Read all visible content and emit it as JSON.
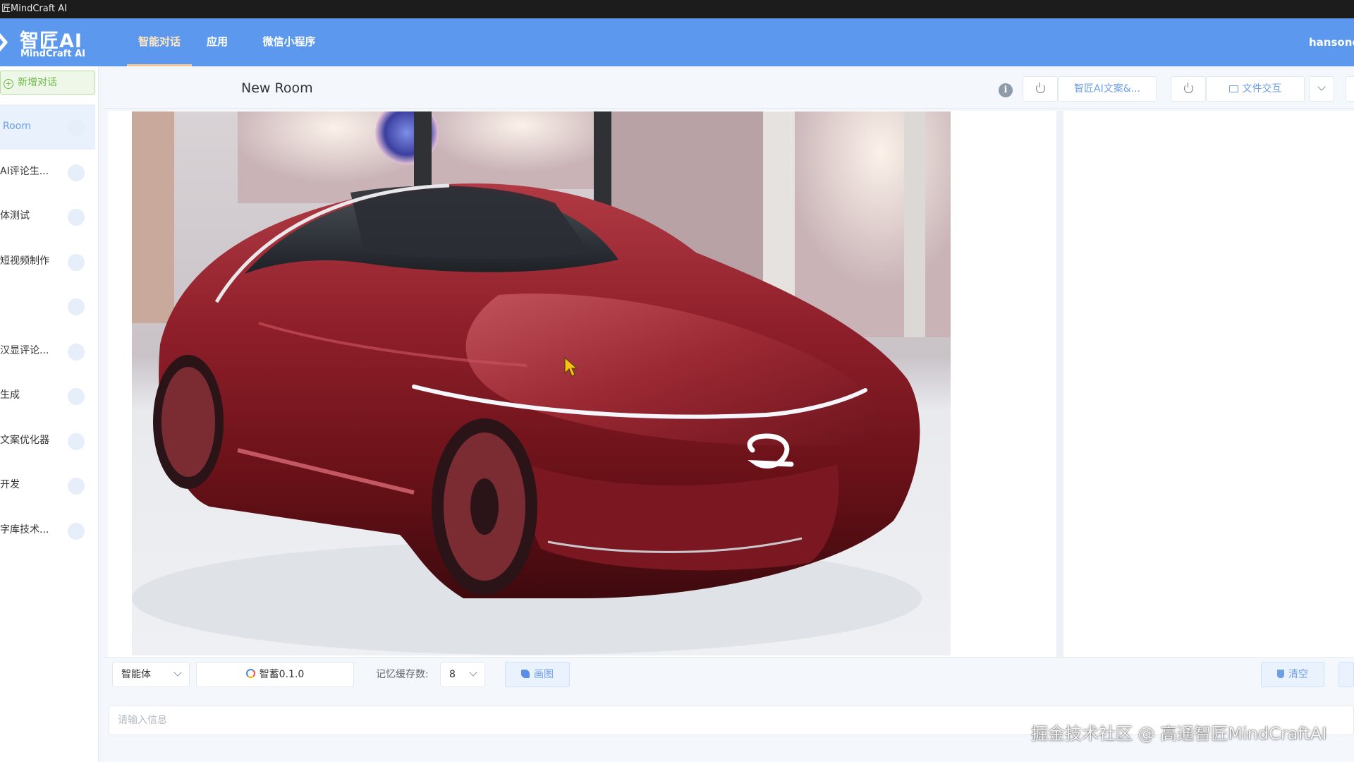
{
  "window": {
    "title": "匠MindCraft AI"
  },
  "brand": {
    "name_cn": "智匠AI",
    "name_en": "MindCraft AI"
  },
  "nav": {
    "tabs": [
      {
        "label": "智能对话",
        "active": true
      },
      {
        "label": "应用",
        "active": false
      },
      {
        "label": "微信小程序",
        "active": false
      }
    ],
    "user": "hansoncu"
  },
  "sidebar": {
    "new_chat_label": "新增对话",
    "items": [
      {
        "label": "Room",
        "active": true
      },
      {
        "label": "AI评论生...",
        "active": false
      },
      {
        "label": "体测试",
        "active": false
      },
      {
        "label": "短视频制作",
        "active": false
      },
      {
        "label": "",
        "active": false
      },
      {
        "label": "汉显评论...",
        "active": false
      },
      {
        "label": "生成",
        "active": false
      },
      {
        "label": "文案优化器",
        "active": false
      },
      {
        "label": "开发",
        "active": false
      },
      {
        "label": "字库技术...",
        "active": false
      }
    ]
  },
  "header": {
    "room_title": "New Room",
    "agent_label": "智匠AI文案&...",
    "file_label": "文件交互"
  },
  "toolbar": {
    "mode_select": "智能体",
    "model_select": "智蓄0.1.0",
    "memory_label": "记忆缓存数:",
    "memory_value": "8",
    "draw_label": "画图",
    "clear_label": "清空"
  },
  "input": {
    "placeholder": "请输入信息"
  },
  "watermark": "掘金技术社区 @ 高通智匠MindCraftAI",
  "colors": {
    "nav_bg": "#5b98ee",
    "accent": "#6d9ee6",
    "active_tab": "#f7c68a",
    "new_chat_green": "#6cb84a",
    "car_red": "#8e1f2a"
  }
}
